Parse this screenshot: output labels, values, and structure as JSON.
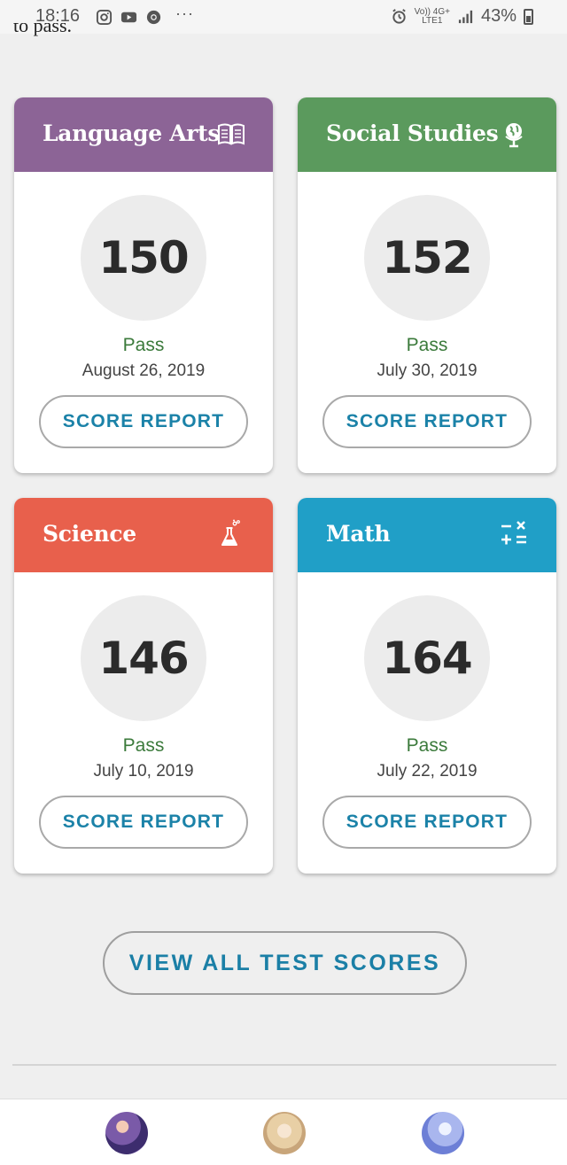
{
  "status_bar": {
    "time": "18:16",
    "dots": "···",
    "volte_top": "Vo)) 4G+",
    "volte_bottom": "LTE1",
    "battery": "43%"
  },
  "cut_text": "to pass.",
  "cards": [
    {
      "title": "Language Arts",
      "score": "150",
      "result": "Pass",
      "date": "August 26, 2019",
      "button": "SCORE REPORT",
      "color": "#8c6496",
      "icon": "book-icon"
    },
    {
      "title": "Social Studies",
      "score": "152",
      "result": "Pass",
      "date": "July 30, 2019",
      "button": "SCORE REPORT",
      "color": "#5b9a5d",
      "icon": "globe-icon"
    },
    {
      "title": "Science",
      "score": "146",
      "result": "Pass",
      "date": "July 10, 2019",
      "button": "SCORE REPORT",
      "color": "#e8604c",
      "icon": "flask-icon"
    },
    {
      "title": "Math",
      "score": "164",
      "result": "Pass",
      "date": "July 22, 2019",
      "button": "SCORE REPORT",
      "color": "#209fc7",
      "icon": "math-symbols-icon"
    }
  ],
  "view_all_label": "VIEW ALL TEST SCORES",
  "colors": {
    "pass_green": "#3b7a3b",
    "button_text": "#1b82a8",
    "background": "#efefef"
  }
}
